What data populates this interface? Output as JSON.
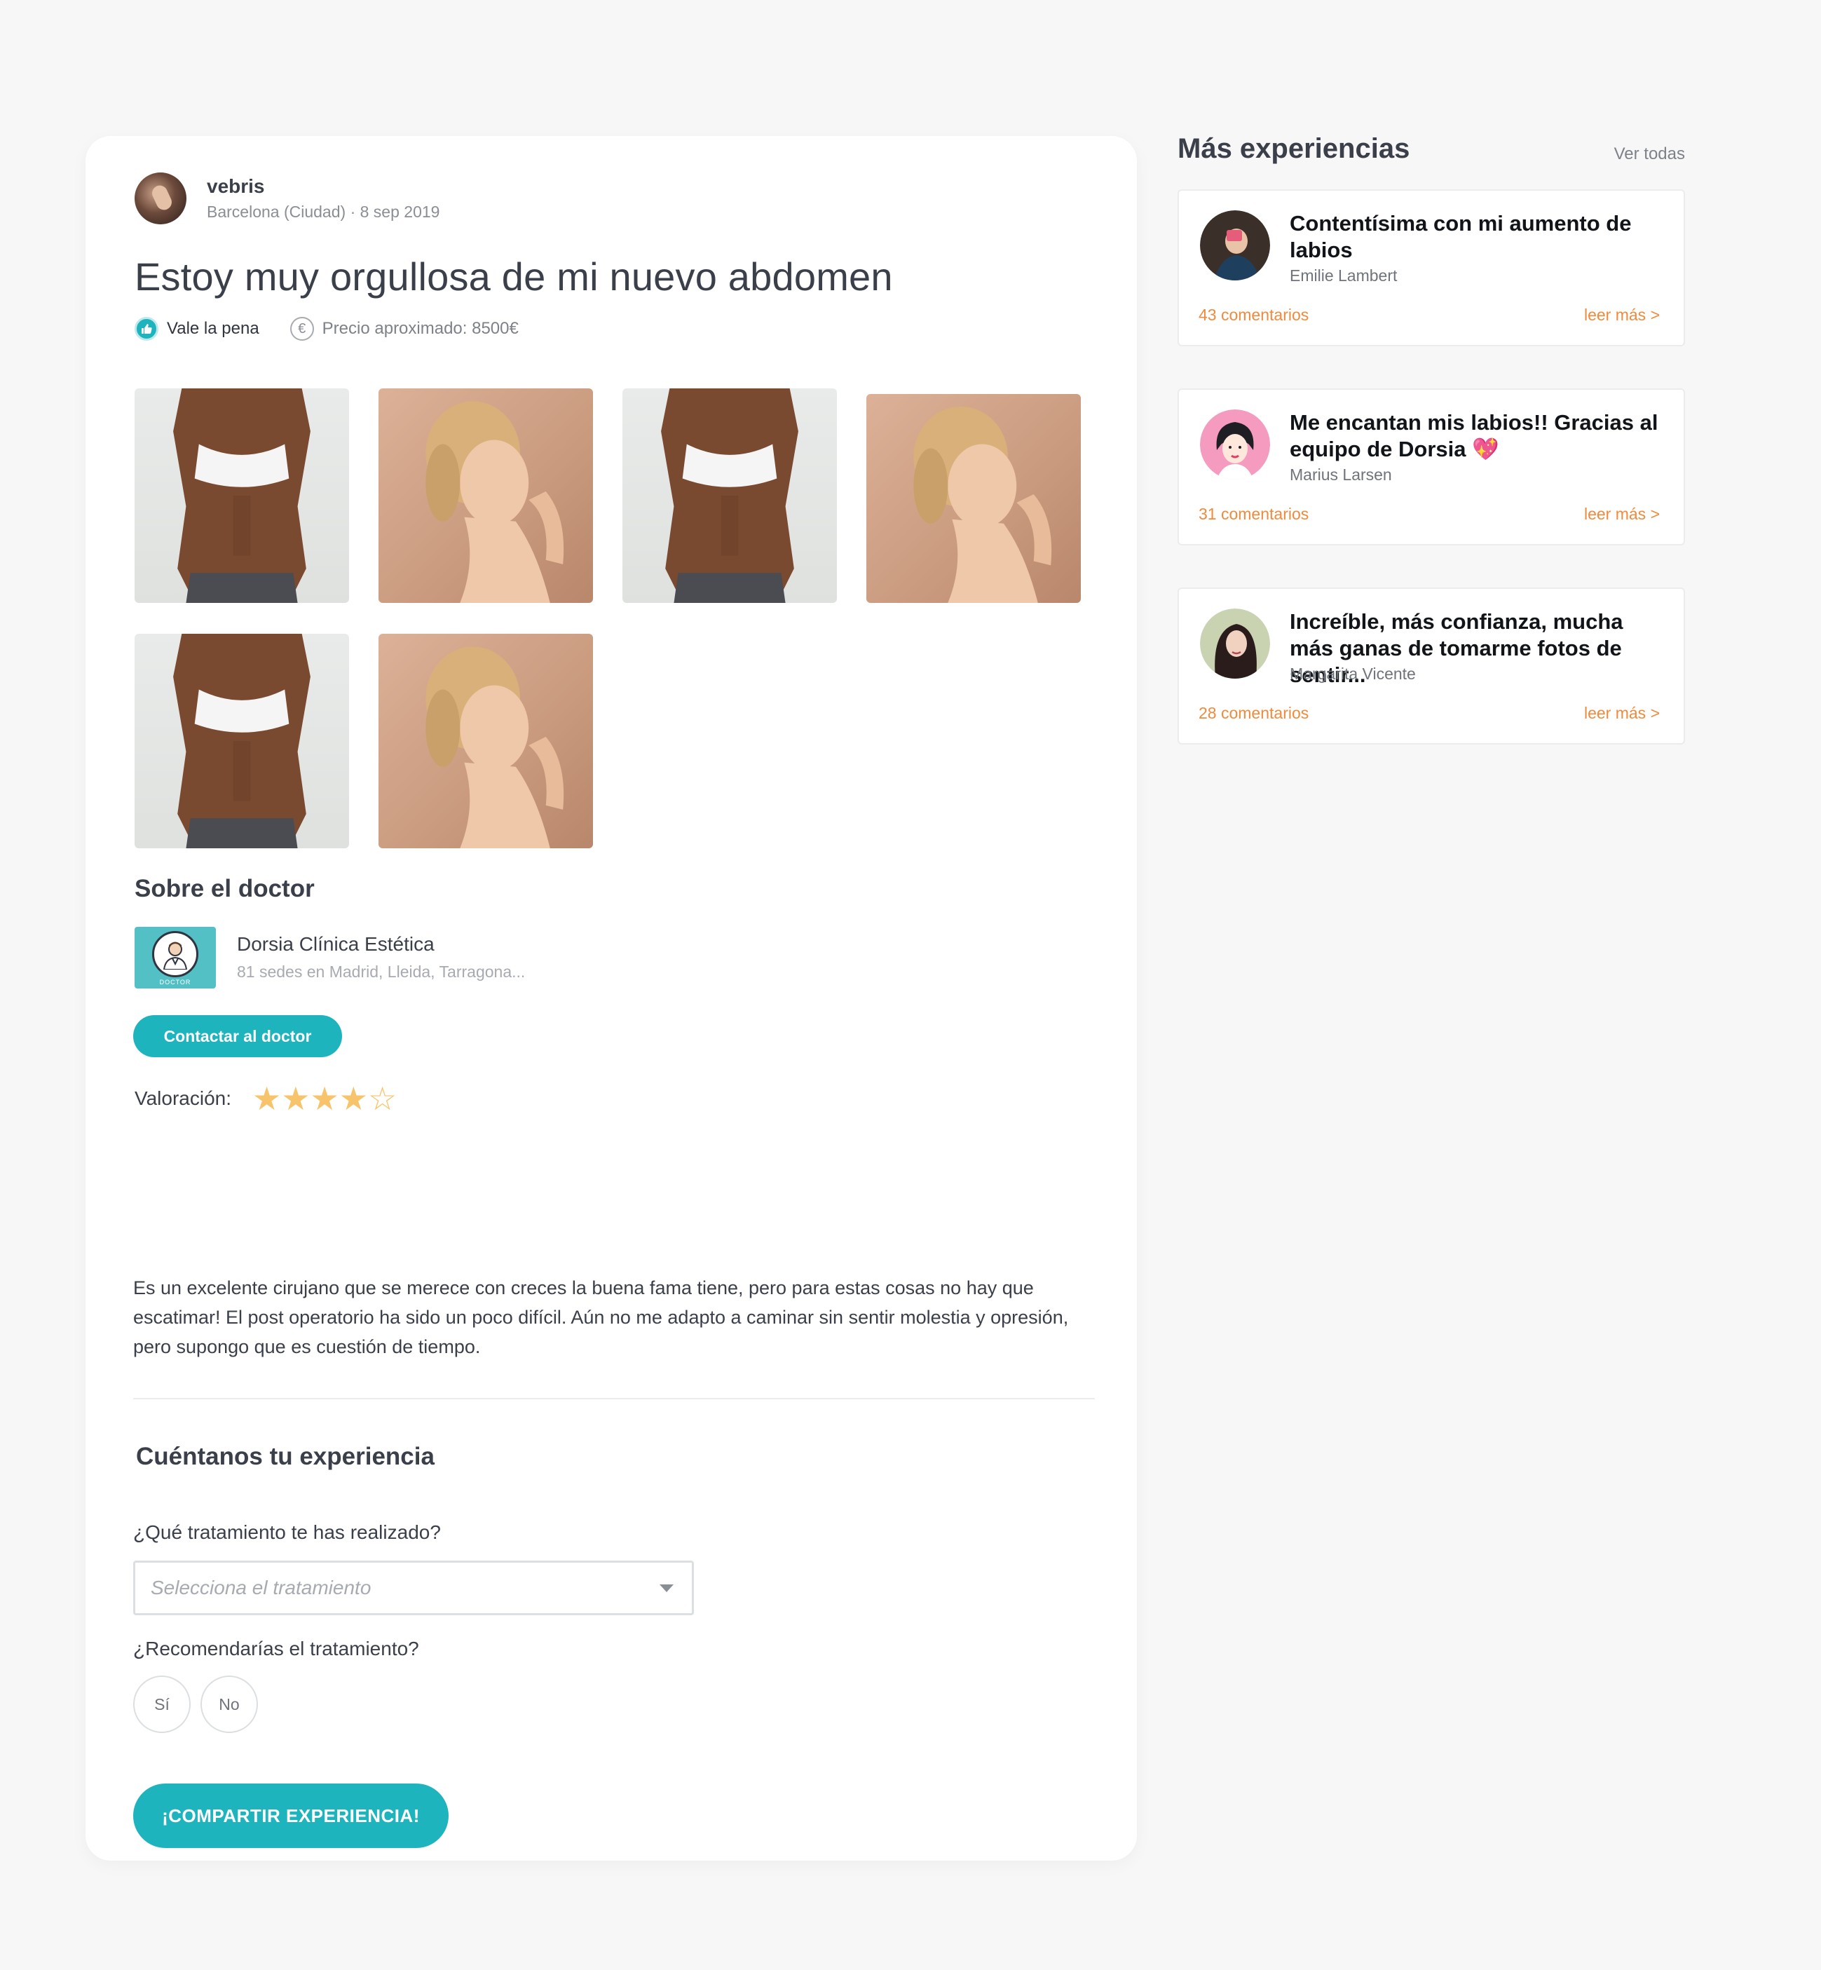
{
  "post": {
    "author": "vebris",
    "location": "Barcelona (Ciudad)",
    "separator": "·",
    "date": "8 sep 2019",
    "title": "Estoy muy orgullosa de mi nuevo abdomen",
    "worth_label": "Vale la pena",
    "price_label": "Precio aproximado: 8500€",
    "photos": [
      "abs",
      "face",
      "abs",
      "face",
      "abs",
      "face"
    ]
  },
  "doctor": {
    "section_title": "Sobre el doctor",
    "name": "Dorsia Clínica Estética",
    "locations": "81 sedes en Madrid, Lleida, Tarragona...",
    "logo_caption": "DOCTOR",
    "contact_label": "Contactar al doctor",
    "rating_label": "Valoración:",
    "rating_value": 4,
    "rating_max": 5
  },
  "review": {
    "text": "Es un excelente cirujano que se merece con creces la buena fama tiene, pero para estas cosas no hay que escatimar! El post operatorio ha sido un poco difícil. Aún no me adapto a caminar sin sentir molestia y opresión, pero supongo que es cuestión de tiempo."
  },
  "form": {
    "section_title": "Cuéntanos tu experiencia",
    "treatment_question": "¿Qué tratamiento te has realizado?",
    "treatment_placeholder": "Selecciona el tratamiento",
    "recommend_question": "¿Recomendarías el tratamiento?",
    "yes_label": "Sí",
    "no_label": "No",
    "submit_label": "¡COMPARTIR EXPERIENCIA!"
  },
  "sidebar": {
    "title": "Más experiencias",
    "see_all": "Ver todas",
    "items": [
      {
        "title": "Contentísima con mi aumento de labios",
        "author": "Emilie Lambert",
        "comments": "43 comentarios",
        "more": "leer más >"
      },
      {
        "title": "Me encantan mis labios!! Gracias al equipo de Dorsia 💖",
        "author": "Marius Larsen",
        "comments": "31 comentarios",
        "more": "leer más >"
      },
      {
        "title": "Increíble, más confianza, mucha más ganas de tomarme fotos de sentir...",
        "author": "Margarita Vicente",
        "comments": "28 comentarios",
        "more": "leer más >"
      }
    ]
  },
  "colors": {
    "accent": "#1db4bd",
    "link_orange": "#f08a3c",
    "star": "#f7c46b",
    "background": "#f7f7f7"
  }
}
